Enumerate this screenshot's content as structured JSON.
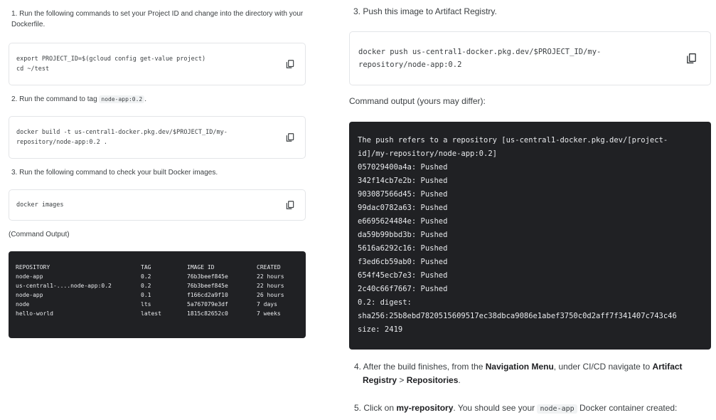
{
  "left": {
    "step1": "1. Run the following commands to set your Project ID and change into the directory with your Dockerfile.",
    "code1": [
      "export PROJECT_ID=$(gcloud config get-value project)",
      "cd ~/test"
    ],
    "step2_prefix": "2. Run the command to tag ",
    "step2_code": "node-app:0.2",
    "step2_suffix": ".",
    "code2": [
      "docker build -t us-central1-docker.pkg.dev/$PROJECT_ID/my-",
      "repository/node-app:0.2 ."
    ],
    "step3": "3. Run the following command to check your built Docker images.",
    "code3": [
      "docker images"
    ],
    "output_label": "(Command Output)",
    "table": {
      "headers": [
        "REPOSITORY",
        "TAG",
        "IMAGE ID",
        "CREATED"
      ],
      "rows": [
        [
          "node-app",
          "0.2",
          "76b3beef845e",
          "22 hours"
        ],
        [
          "us-central1-....node-app:0.2",
          "0.2",
          "76b3beef845e",
          "22 hours"
        ],
        [
          "node-app",
          "0.1",
          "f166cd2a9f10",
          "26 hours"
        ],
        [
          "node",
          "lts",
          "5a767079e3df",
          "7 days"
        ],
        [
          "hello-world",
          "latest",
          "1815c82652c0",
          "7 weeks"
        ]
      ]
    }
  },
  "right": {
    "step3": "3. Push this image to Artifact Registry.",
    "code": [
      "docker push us-central1-docker.pkg.dev/$PROJECT_ID/my-",
      "repository/node-app:0.2"
    ],
    "output_label": "Command output (yours may differ):",
    "output": [
      "The push refers to a repository [us-central1-docker.pkg.dev/[project-",
      "id]/my-repository/node-app:0.2]",
      "057029400a4a: Pushed",
      "342f14cb7e2b: Pushed",
      "903087566d45: Pushed",
      "99dac0782a63: Pushed",
      "e6695624484e: Pushed",
      "da59b99bbd3b: Pushed",
      "5616a6292c16: Pushed",
      "f3ed6cb59ab0: Pushed",
      "654f45ecb7e3: Pushed",
      "2c40c66f7667: Pushed",
      "0.2: digest:",
      "sha256:25b8ebd7820515609517ec38dbca9086e1abef3750c0d2aff7f341407c743c46",
      "size: 2419"
    ],
    "step4": {
      "a": "4. After the build finishes, from the ",
      "b": "Navigation Menu",
      "c": ", under CI/CD navigate to ",
      "d": "Artifact",
      "e": "Registry",
      "f": " > ",
      "g": "Repositories",
      "h": "."
    },
    "step5": {
      "a": "5. Click on ",
      "b": "my-repository",
      "c": ". You should see your ",
      "d": "node-app",
      "e": " Docker container created:"
    }
  },
  "icons": {
    "copy": "copy-icon"
  },
  "colors": {
    "terminal_bg": "#202124",
    "terminal_text": "#e8eaed",
    "border": "#e3e5e8"
  }
}
